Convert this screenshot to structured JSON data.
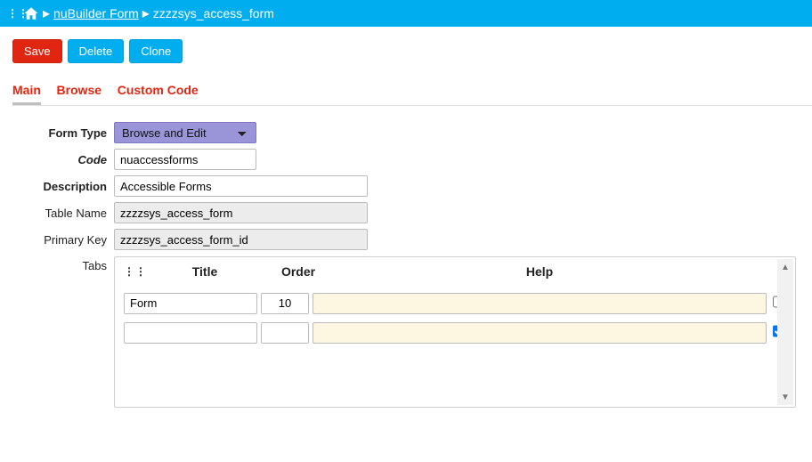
{
  "breadcrumb": {
    "link": "nuBuilder Form",
    "current": "zzzzsys_access_form"
  },
  "actions": {
    "save": "Save",
    "delete": "Delete",
    "clone": "Clone"
  },
  "tabs": {
    "main": "Main",
    "browse": "Browse",
    "custom": "Custom Code"
  },
  "form": {
    "labels": {
      "formType": "Form Type",
      "code": "Code",
      "description": "Description",
      "tableName": "Table Name",
      "primaryKey": "Primary Key",
      "tabs": "Tabs"
    },
    "values": {
      "formType": "Browse and Edit",
      "code": "nuaccessforms",
      "description": "Accessible Forms",
      "tableName": "zzzzsys_access_form",
      "primaryKey": "zzzzsys_access_form_id"
    }
  },
  "subform": {
    "headers": {
      "title": "Title",
      "order": "Order",
      "help": "Help"
    },
    "rows": [
      {
        "title": "Form",
        "order": "10",
        "help": "",
        "checked": false
      },
      {
        "title": "",
        "order": "",
        "help": "",
        "checked": true
      }
    ]
  }
}
